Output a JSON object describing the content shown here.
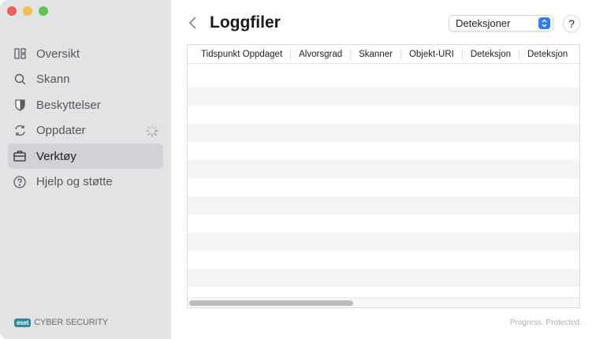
{
  "window": {
    "controls": [
      {
        "name": "close",
        "color": "#ed5f57"
      },
      {
        "name": "minimize",
        "color": "#f4bd4f"
      },
      {
        "name": "zoom",
        "color": "#5fc453"
      }
    ]
  },
  "sidebar": {
    "items": [
      {
        "label": "Oversikt",
        "icon": "dashboard-icon"
      },
      {
        "label": "Skann",
        "icon": "search-icon"
      },
      {
        "label": "Beskyttelser",
        "icon": "shield-icon"
      },
      {
        "label": "Oppdater",
        "icon": "refresh-icon"
      },
      {
        "label": "Verktøy",
        "icon": "toolbox-icon",
        "active": true
      },
      {
        "label": "Hjelp og støtte",
        "icon": "help-circle-icon"
      }
    ],
    "logo": {
      "badge": "eset",
      "text": "CYBER SECURITY"
    }
  },
  "header": {
    "title": "Loggfiler",
    "select_value": "Deteksjoner",
    "help_label": "?"
  },
  "table": {
    "columns": [
      "Tidspunkt Oppdaget",
      "Alvorsgrad",
      "Skanner",
      "Objekt-URI",
      "Deteksjon",
      "Deteksjon"
    ],
    "rows": []
  },
  "footer": {
    "tagline": "Progress. Protected."
  },
  "colors": {
    "accent": "#2f7cf6",
    "brand": "#2f8a96"
  }
}
